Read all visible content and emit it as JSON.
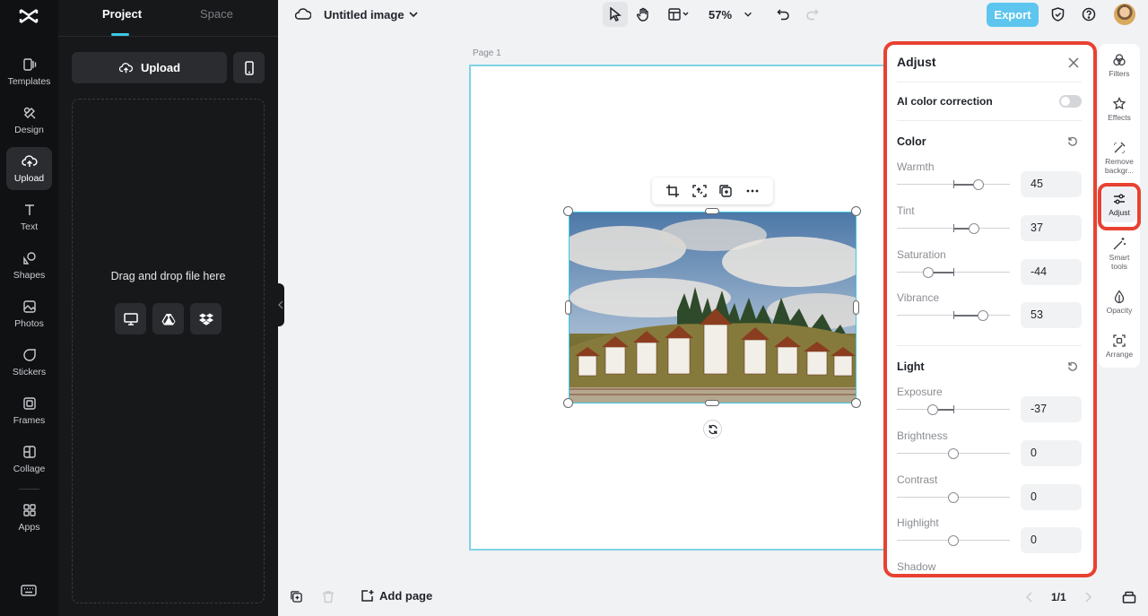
{
  "nav": {
    "items": [
      {
        "label": "Templates",
        "icon": "templates-icon"
      },
      {
        "label": "Design",
        "icon": "design-icon"
      },
      {
        "label": "Upload",
        "icon": "upload-icon",
        "active": true
      },
      {
        "label": "Text",
        "icon": "text-icon"
      },
      {
        "label": "Shapes",
        "icon": "shapes-icon"
      },
      {
        "label": "Photos",
        "icon": "photos-icon"
      },
      {
        "label": "Stickers",
        "icon": "stickers-icon"
      },
      {
        "label": "Frames",
        "icon": "frames-icon"
      },
      {
        "label": "Collage",
        "icon": "collage-icon"
      },
      {
        "label": "Apps",
        "icon": "apps-icon"
      }
    ]
  },
  "left_panel": {
    "tabs": [
      "Project",
      "Space"
    ],
    "active_tab": "Project",
    "upload_label": "Upload",
    "drop_text": "Drag and drop file here"
  },
  "topbar": {
    "title": "Untitled image",
    "zoom": "57%",
    "export_label": "Export"
  },
  "canvas": {
    "page_label": "Page 1"
  },
  "bottombar": {
    "add_page_label": "Add page",
    "pager": "1/1"
  },
  "adjust": {
    "title": "Adjust",
    "ai_label": "AI color correction",
    "ai_enabled": false,
    "sections": [
      {
        "title": "Color",
        "controls": [
          {
            "label": "Warmth",
            "value": "45"
          },
          {
            "label": "Tint",
            "value": "37"
          },
          {
            "label": "Saturation",
            "value": "-44"
          },
          {
            "label": "Vibrance",
            "value": "53"
          }
        ]
      },
      {
        "title": "Light",
        "controls": [
          {
            "label": "Exposure",
            "value": "-37"
          },
          {
            "label": "Brightness",
            "value": "0"
          },
          {
            "label": "Contrast",
            "value": "0"
          },
          {
            "label": "Highlight",
            "value": "0"
          },
          {
            "label": "Shadow",
            "value": ""
          }
        ]
      }
    ]
  },
  "right_rail": {
    "items": [
      {
        "label": "Filters",
        "icon": "filters-icon"
      },
      {
        "label": "Effects",
        "icon": "effects-icon"
      },
      {
        "label": "Remove backgr...",
        "icon": "remove-background-icon"
      },
      {
        "label": "Adjust",
        "icon": "adjust-icon",
        "active": true
      },
      {
        "label": "Smart tools",
        "icon": "smart-tools-icon"
      },
      {
        "label": "Opacity",
        "icon": "opacity-icon"
      },
      {
        "label": "Arrange",
        "icon": "arrange-icon"
      }
    ]
  },
  "colors": {
    "accent": "#3ec8e6",
    "export": "#5ec6ee",
    "highlight_outline": "#e84131"
  }
}
